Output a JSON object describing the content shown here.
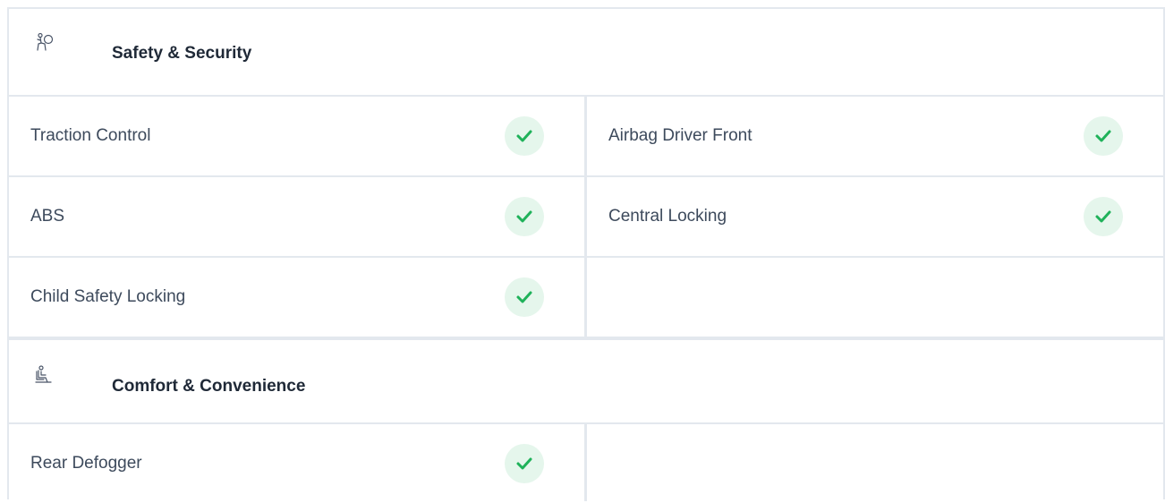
{
  "sections": [
    {
      "title": "Safety & Security",
      "icon": "airbag-person-icon",
      "features": [
        {
          "label": "Traction Control",
          "available": true
        },
        {
          "label": "Airbag Driver Front",
          "available": true
        },
        {
          "label": "ABS",
          "available": true
        },
        {
          "label": "Central Locking",
          "available": true
        },
        {
          "label": "Child Safety Locking",
          "available": true
        }
      ]
    },
    {
      "title": "Comfort & Convenience",
      "icon": "seated-person-icon",
      "features": [
        {
          "label": "Rear Defogger",
          "available": true
        }
      ]
    }
  ],
  "colors": {
    "check": "#1fb25a",
    "check_bg": "#e5f6ec",
    "border": "#e3e8ee",
    "title": "#1f2937",
    "text": "#3d4a5c"
  }
}
